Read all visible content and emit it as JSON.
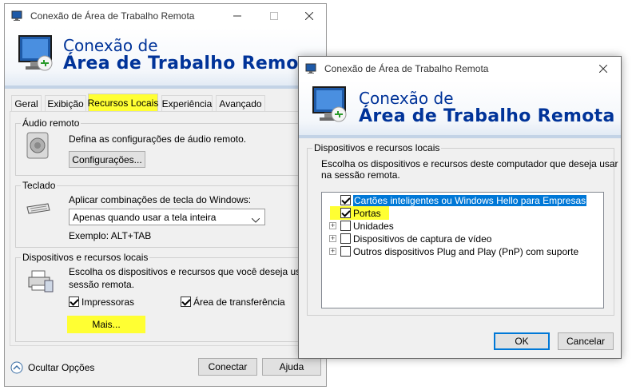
{
  "back_window": {
    "title": "Conexão de Área de Trabalho Remota",
    "banner_line1": "Conexão de",
    "banner_line2": "Área de Trabalho Remota",
    "tabs": [
      "Geral",
      "Exibição",
      "Recursos Locais",
      "Experiência",
      "Avançado"
    ],
    "active_tab": "Recursos Locais",
    "audio": {
      "group_label": "Áudio remoto",
      "description": "Defina as configurações de áudio remoto.",
      "button": "Configurações..."
    },
    "keyboard": {
      "group_label": "Teclado",
      "description": "Aplicar combinações de tecla do Windows:",
      "select_value": "Apenas quando usar a tela inteira",
      "example": "Exemplo: ALT+TAB"
    },
    "devices": {
      "group_label": "Dispositivos e recursos locais",
      "description_line1": "Escolha os dispositivos e recursos que você deseja usar na",
      "description_line2": "sessão remota.",
      "printers_label": "Impressoras",
      "printers_checked": true,
      "clipboard_label": "Área de transferência",
      "clipboard_checked": true,
      "more_button": "Mais..."
    },
    "hide_options": "Ocultar Opções",
    "connect_button": "Conectar",
    "help_button": "Ajuda"
  },
  "front_window": {
    "title": "Conexão de Área de Trabalho Remota",
    "banner_line1": "Conexão de",
    "banner_line2": "Área de Trabalho Remota",
    "group_label": "Dispositivos e recursos locais",
    "description_line1": "Escolha os dispositivos e recursos deste computador que deseja usar",
    "description_line2": "na sessão remota.",
    "tree_items": [
      {
        "label": "Cartões inteligentes ou Windows Hello para Empresas",
        "checked": true,
        "expandable": false,
        "selected": true
      },
      {
        "label": "Portas",
        "checked": true,
        "expandable": false,
        "selected": false
      },
      {
        "label": "Unidades",
        "checked": false,
        "expandable": true,
        "selected": false
      },
      {
        "label": "Dispositivos de captura de vídeo",
        "checked": false,
        "expandable": true,
        "selected": false
      },
      {
        "label": "Outros dispositivos Plug and Play (PnP) com suporte",
        "checked": false,
        "expandable": true,
        "selected": false
      }
    ],
    "ok_button": "OK",
    "cancel_button": "Cancelar"
  },
  "colors": {
    "highlight": "#ffff33",
    "banner_text": "#003399",
    "selection": "#0078d7"
  }
}
